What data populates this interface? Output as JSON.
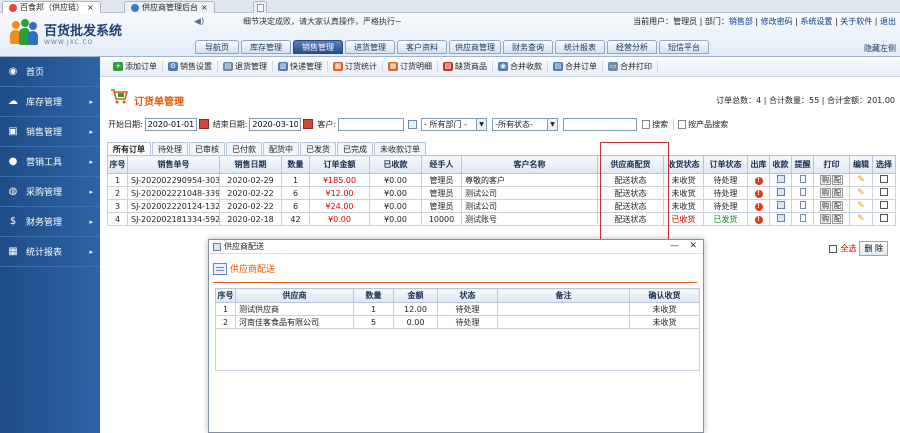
{
  "browser": {
    "tabs": [
      {
        "label": "百食邦（供应链）",
        "close": "×"
      },
      {
        "label": "供应商管理后台",
        "close": "×"
      }
    ]
  },
  "header": {
    "logo_title": "百货批发系统",
    "logo_sub": "WWW.JXC.CO",
    "notice": "细节决定成败，请大家认真操作，严格执行~",
    "user_label": "当前用户：",
    "user_name": "管理员",
    "dept_label": "部门：",
    "dept_name": "销售部",
    "links": [
      "修改密码",
      "系统设置",
      "关于软件",
      "退出"
    ],
    "hide_top": "隐藏左侧"
  },
  "top_nav": [
    "导航页",
    "库存管理",
    "销售管理",
    "进货管理",
    "客户资料",
    "供应商管理",
    "财务查询",
    "统计报表",
    "经营分析",
    "短信平台"
  ],
  "top_nav_active": 2,
  "sidebar": {
    "items": [
      {
        "label": "首页",
        "icon": "home-icon",
        "glyph": "◉",
        "arrow": ""
      },
      {
        "label": "库存管理",
        "icon": "cloud-icon",
        "glyph": "☁",
        "arrow": "▸"
      },
      {
        "label": "销售管理",
        "icon": "briefcase-icon",
        "glyph": "▣",
        "arrow": "▸"
      },
      {
        "label": "营销工具",
        "icon": "user-icon",
        "glyph": "●",
        "arrow": "▸"
      },
      {
        "label": "采购管理",
        "icon": "globe-icon",
        "glyph": "◍",
        "arrow": "▸"
      },
      {
        "label": "财务管理",
        "icon": "dollar-icon",
        "glyph": "$",
        "arrow": "▸"
      },
      {
        "label": "统计报表",
        "icon": "chart-icon",
        "glyph": "▦",
        "arrow": "▸"
      }
    ]
  },
  "toolbar": [
    {
      "label": "添加订单",
      "icon": "add-icon",
      "color": "#2e9d3a",
      "glyph": "+"
    },
    {
      "label": "销售设置",
      "icon": "settings-icon",
      "color": "#4f7cb8",
      "glyph": "⚙"
    },
    {
      "label": "退货管理",
      "icon": "return-icon",
      "color": "#6f8aa8",
      "glyph": "▤"
    },
    {
      "label": "快递管理",
      "icon": "express-icon",
      "color": "#4f7cb8",
      "glyph": "▥"
    },
    {
      "label": "订货统计",
      "icon": "stats-icon",
      "color": "#d06a2a",
      "glyph": "▦"
    },
    {
      "label": "订货明细",
      "icon": "detail-icon",
      "color": "#d06a2a",
      "glyph": "▦"
    },
    {
      "label": "缺货商品",
      "icon": "shortage-icon",
      "color": "#c03a2a",
      "glyph": "▨"
    },
    {
      "label": "合并收款",
      "icon": "merge-pay-icon",
      "color": "#4f7cb8",
      "glyph": "◉"
    },
    {
      "label": "合并订单",
      "icon": "merge-order-icon",
      "color": "#4f7cb8",
      "glyph": "▤"
    },
    {
      "label": "合并打印",
      "icon": "merge-print-icon",
      "color": "#6f8aa8",
      "glyph": "▭"
    }
  ],
  "page": {
    "title": "订货单管理",
    "summary": "订单总数：4 | 合计数量：55 | 合计金额：201.00"
  },
  "filter": {
    "start_label": "开始日期:",
    "start_value": "2020-01-01",
    "end_label": "结束日期:",
    "end_value": "2020-03-10",
    "customer_label": "客户:",
    "customer_value": "",
    "dept_select": "- 所有部门 -",
    "status_select": "-所有状态-",
    "keyword_value": "",
    "search_label": "搜索",
    "product_search_label": "按产品搜索"
  },
  "status_tabs": [
    "所有订单",
    "待处理",
    "已审核",
    "已付款",
    "配货中",
    "已发货",
    "已完成",
    "未收款订单"
  ],
  "status_tab_active": 0,
  "orders": {
    "columns": [
      "序号",
      "销售单号",
      "销售日期",
      "数量",
      "订单金额",
      "已收款",
      "经手人",
      "客户名称",
      "供应商配货",
      "收货状态",
      "订单状态",
      "出库",
      "收款",
      "提醒",
      "打印",
      "编辑",
      "选择"
    ],
    "rows": [
      {
        "no": "1",
        "order_no": "SJ-202002290954-303",
        "date": "2020-02-29",
        "qty": "1",
        "amount": "¥185.00",
        "paid": "¥0.00",
        "handler": "管理员",
        "customer": "尊敬的客户",
        "supplier": "配送状态",
        "receive": "未收货",
        "status": "待处理",
        "status_color": "normal",
        "print_a": "购",
        "print_b": "配"
      },
      {
        "no": "2",
        "order_no": "SJ-202002221048-339",
        "date": "2020-02-22",
        "qty": "6",
        "amount": "¥12.00",
        "paid": "¥0.00",
        "handler": "管理员",
        "customer": "测试公司",
        "supplier": "配送状态",
        "receive": "未收货",
        "status": "待处理",
        "status_color": "normal",
        "print_a": "购",
        "print_b": "配"
      },
      {
        "no": "3",
        "order_no": "SJ-202002220124-132",
        "date": "2020-02-22",
        "qty": "6",
        "amount": "¥24.00",
        "paid": "¥0.00",
        "handler": "管理员",
        "customer": "测试公司",
        "supplier": "配送状态",
        "receive": "未收货",
        "status": "待处理",
        "status_color": "normal",
        "print_a": "购",
        "print_b": "配"
      },
      {
        "no": "4",
        "order_no": "SJ-202002181334-592",
        "date": "2020-02-18",
        "qty": "42",
        "amount": "¥0.00",
        "paid": "¥0.00",
        "handler": "10000",
        "customer": "测试账号",
        "supplier": "配送状态",
        "receive": "已收货",
        "status": "已发货",
        "status_color": "green",
        "print_a": "购",
        "print_b": "配"
      }
    ]
  },
  "bulk": {
    "select_all": "全选",
    "delete": "删 除"
  },
  "dialog": {
    "title": "供应商配送",
    "heading": "供应商配送",
    "minimize": "—",
    "close": "✕",
    "columns": [
      "序号",
      "供应商",
      "数量",
      "金额",
      "状态",
      "备注",
      "确认收货"
    ],
    "rows": [
      {
        "no": "1",
        "supplier": "测试供应商",
        "qty": "1",
        "amount": "12.00",
        "status": "待处理",
        "note": "",
        "confirm": "未收货"
      },
      {
        "no": "2",
        "supplier": "河南佳客食品有限公司",
        "qty": "5",
        "amount": "0.00",
        "status": "待处理",
        "note": "",
        "confirm": "未收货"
      }
    ]
  },
  "colors": {
    "accent": "#e05a0c",
    "sidebar": "#1e4d87",
    "amount_red": "#e00000",
    "ok_green": "#0a8a1a",
    "highlight_box": "#c4343a"
  }
}
